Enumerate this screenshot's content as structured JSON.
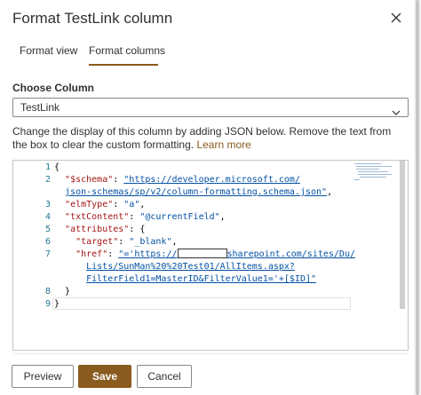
{
  "panel": {
    "title": "Format TestLink column",
    "close_icon": "close-icon"
  },
  "tabs": [
    {
      "label": "Format view",
      "selected": false
    },
    {
      "label": "Format columns",
      "selected": true
    }
  ],
  "choose_column": {
    "label": "Choose Column",
    "selected_value": "TestLink"
  },
  "help": {
    "text": "Change the display of this column by adding JSON below. Remove the text from the box to clear the custom formatting.",
    "link": "Learn more"
  },
  "editor": {
    "line_numbers": [
      "1",
      "2",
      "",
      "3",
      "4",
      "5",
      "6",
      "7",
      "",
      "",
      "8",
      "9"
    ],
    "lines": {
      "l1": "{",
      "l2_key": "\"$schema\"",
      "l2_val": "\"https://developer.microsoft.com/",
      "l2b": "json-schemas/sp/v2/column-formatting.schema.json\"",
      "l3_key": "\"elmType\"",
      "l3_val": "\"a\"",
      "l4_key": "\"txtContent\"",
      "l4_val": "\"@currentField\"",
      "l5_key": "\"attributes\"",
      "l6_key": "\"target\"",
      "l6_val": "\"_blank\"",
      "l7_key": "\"href\"",
      "l7_val_a": "\"='https://",
      "l7_val_b": "sharepoint.com/sites/Du/",
      "l7b": "Lists/SunMan%20%20Test01/AllItems.aspx?",
      "l7c": "FilterField1=MasterID&FilterValue1='+[$ID]\"",
      "l8": "}",
      "l9": "}"
    }
  },
  "buttons": {
    "preview": "Preview",
    "save": "Save",
    "cancel": "Cancel"
  },
  "colors": {
    "accent": "#8a5b1f",
    "line_number": "#237893",
    "json_key": "#a31515",
    "json_string": "#0451a5"
  }
}
